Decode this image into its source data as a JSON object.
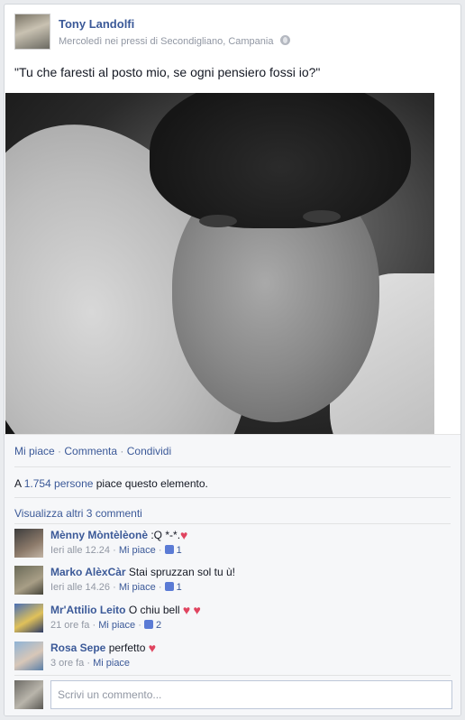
{
  "post": {
    "author": "Tony Landolfi",
    "meta_place": "Mercoledì nei pressi di Secondigliano, Campania",
    "text": "\"Tu che faresti al posto mio, se ogni pensiero fossi io?\"",
    "audience_icon": "globe-icon"
  },
  "actions": {
    "like": "Mi piace",
    "sep": "·",
    "comment": "Commenta",
    "share": "Condividi"
  },
  "likes_summary": {
    "prefix": "A ",
    "count": "1.754 persone",
    "suffix": " piace questo elemento."
  },
  "view_more": "Visualizza altri 3 commenti",
  "comments": [
    {
      "name": "Mènny Mòntèlèonè",
      "text": " :Q *-*.",
      "heart": "♥",
      "time": "Ieri alle 12.24",
      "sep": " · ",
      "like_label": "Mi piace",
      "sep2": " · ",
      "likes": "1"
    },
    {
      "name": "Marko AlèxCàr",
      "text": " Stai spruzzan sol tu ù!",
      "time": "Ieri alle 14.26",
      "sep": " · ",
      "like_label": "Mi piace",
      "sep2": " · ",
      "likes": "1"
    },
    {
      "name": "Mr'Attilio Leito",
      "text": " O chiu bell ",
      "heart": "♥",
      "heart2": "♥",
      "time": "21 ore fa",
      "sep": " · ",
      "like_label": "Mi piace",
      "sep2": " · ",
      "likes": "2"
    },
    {
      "name": "Rosa Sepe",
      "text": " perfetto ",
      "heart": "♥",
      "time": "3 ore fa",
      "sep": " · ",
      "like_label": "Mi piace"
    }
  ],
  "compose": {
    "placeholder": "Scrivi un commento..."
  },
  "colors": {
    "link": "#3b5998",
    "muted": "#9197a3",
    "heart": "#e0445f"
  }
}
